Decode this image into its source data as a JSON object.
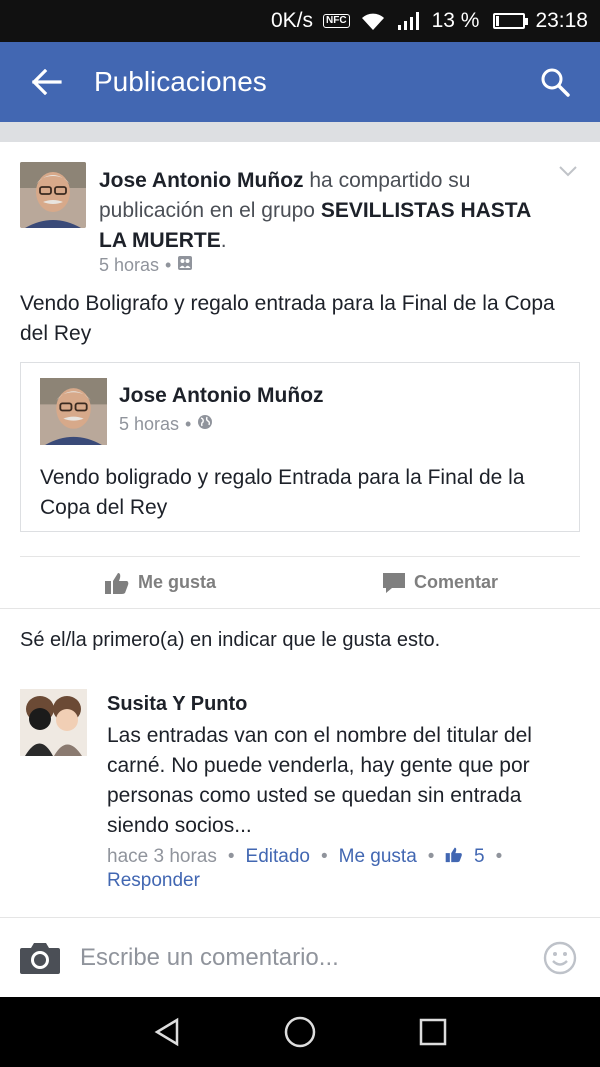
{
  "status_bar": {
    "net_speed": "0K/s",
    "nfc": "NFC",
    "battery": "13 %",
    "battery_level": 0.13,
    "time": "23:18"
  },
  "app_bar": {
    "title": "Publicaciones",
    "back_icon": "arrow-left-icon",
    "search_icon": "search-icon",
    "color": "#4267b2"
  },
  "post": {
    "author": "Jose Antonio Muñoz",
    "action_text": " ha compartido su publicación en el grupo ",
    "group": "SEVILLISTAS HASTA LA MUERTE",
    "period": ".",
    "time": "5 horas",
    "meta_sep": "•",
    "text": "Vendo Boligrafo y regalo entrada para la Final de la Copa del Rey",
    "shared": {
      "author": "Jose Antonio Muñoz",
      "time": "5 horas",
      "meta_sep": "•",
      "text": "Vendo boligrado y regalo Entrada para la Final de la Copa del Rey"
    },
    "actions": {
      "like_label": "Me gusta",
      "comment_label": "Comentar"
    }
  },
  "likes_summary": "Sé el/la primero(a) en indicar que le gusta esto.",
  "comment": {
    "author": "Susita Y Punto",
    "text": "Las entradas van con el nombre del  titular del carné. No puede venderla, hay gente que por personas como usted se quedan sin entrada siendo socios...",
    "time": "hace 3 horas",
    "sep": "•",
    "edited_label": "Editado",
    "like_label": "Me gusta",
    "like_count": "5",
    "reply_label": "Responder"
  },
  "composer": {
    "placeholder": "Escribe un comentario..."
  }
}
